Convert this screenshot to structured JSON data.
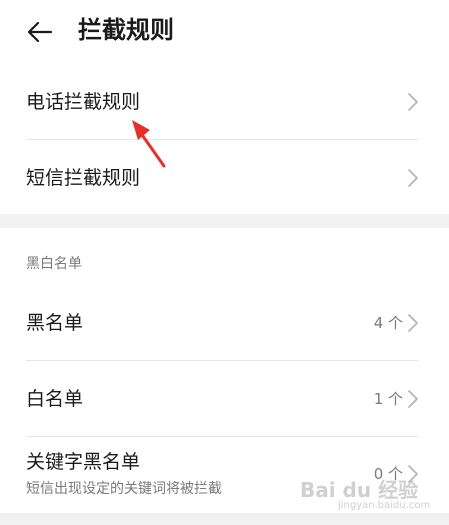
{
  "header": {
    "title": "拦截规则",
    "back_icon": "arrow-left-icon"
  },
  "rules_section": {
    "items": [
      {
        "label": "电话拦截规则"
      },
      {
        "label": "短信拦截规则"
      }
    ]
  },
  "lists_section": {
    "title": "黑白名单",
    "items": [
      {
        "label": "黑名单",
        "count": "4 个"
      },
      {
        "label": "白名单",
        "count": "1 个"
      },
      {
        "label": "关键字黑名单",
        "subtitle": "短信出现设定的关键词将被拦截",
        "count": "0 个"
      }
    ]
  },
  "watermark": {
    "main": "Bai du 经验",
    "sub": "jingyan.baidu.com"
  },
  "colors": {
    "annotation_arrow": "#e8302a",
    "background": "#f1f1f1",
    "card": "#ffffff",
    "secondary_text": "#7a7a7a"
  }
}
